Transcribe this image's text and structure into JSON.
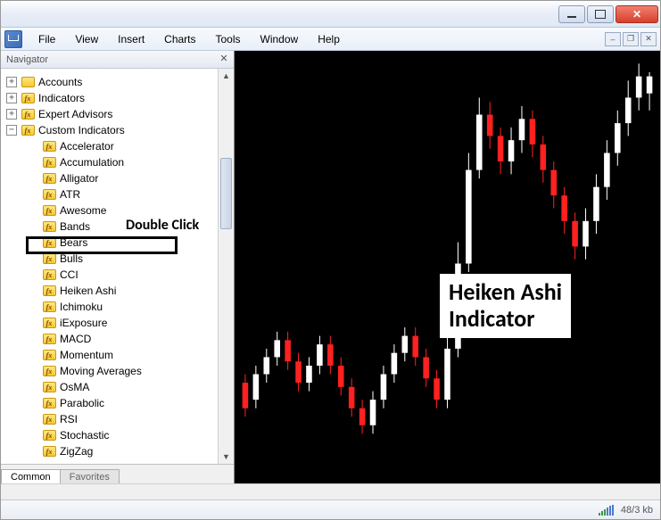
{
  "menubar": {
    "items": [
      "File",
      "View",
      "Insert",
      "Charts",
      "Tools",
      "Window",
      "Help"
    ]
  },
  "navigator": {
    "title": "Navigator",
    "tabs": {
      "active": "Common",
      "inactive": "Favorites"
    },
    "tree": {
      "top": [
        {
          "label": "Accounts",
          "expander": "+",
          "icon": "folder"
        },
        {
          "label": "Indicators",
          "expander": "+",
          "icon": "fx"
        },
        {
          "label": "Expert Advisors",
          "expander": "+",
          "icon": "fx"
        },
        {
          "label": "Custom Indicators",
          "expander": "−",
          "icon": "fx"
        }
      ],
      "custom": [
        "Accelerator",
        "Accumulation",
        "Alligator",
        "ATR",
        "Awesome",
        "Bands",
        "Bears",
        "Bulls",
        "CCI",
        "Heiken Ashi",
        "Ichimoku",
        "iExposure",
        "MACD",
        "Momentum",
        "Moving Averages",
        "OsMA",
        "Parabolic",
        "RSI",
        "Stochastic",
        "ZigZag"
      ],
      "highlighted": "Heiken Ashi"
    }
  },
  "annotations": {
    "double_click": "Double Click",
    "main_line1": "Heiken Ashi",
    "main_line2": "Indicator"
  },
  "statusbar": {
    "text": "48/3 kb"
  },
  "chart_data": {
    "type": "candlestick",
    "note": "approximate Heiken-Ashi candles, values read relative to panel (0=bottom,1=top)",
    "candles": [
      {
        "o": 0.22,
        "c": 0.16,
        "h": 0.24,
        "l": 0.14,
        "color": "red"
      },
      {
        "o": 0.18,
        "c": 0.24,
        "h": 0.26,
        "l": 0.16,
        "color": "white"
      },
      {
        "o": 0.24,
        "c": 0.28,
        "h": 0.3,
        "l": 0.22,
        "color": "white"
      },
      {
        "o": 0.28,
        "c": 0.32,
        "h": 0.34,
        "l": 0.26,
        "color": "white"
      },
      {
        "o": 0.32,
        "c": 0.27,
        "h": 0.34,
        "l": 0.25,
        "color": "red"
      },
      {
        "o": 0.27,
        "c": 0.22,
        "h": 0.29,
        "l": 0.2,
        "color": "red"
      },
      {
        "o": 0.22,
        "c": 0.26,
        "h": 0.28,
        "l": 0.2,
        "color": "white"
      },
      {
        "o": 0.26,
        "c": 0.31,
        "h": 0.33,
        "l": 0.24,
        "color": "white"
      },
      {
        "o": 0.31,
        "c": 0.26,
        "h": 0.33,
        "l": 0.24,
        "color": "red"
      },
      {
        "o": 0.26,
        "c": 0.21,
        "h": 0.28,
        "l": 0.19,
        "color": "red"
      },
      {
        "o": 0.21,
        "c": 0.16,
        "h": 0.23,
        "l": 0.14,
        "color": "red"
      },
      {
        "o": 0.16,
        "c": 0.12,
        "h": 0.18,
        "l": 0.1,
        "color": "red"
      },
      {
        "o": 0.12,
        "c": 0.18,
        "h": 0.2,
        "l": 0.1,
        "color": "white"
      },
      {
        "o": 0.18,
        "c": 0.24,
        "h": 0.26,
        "l": 0.16,
        "color": "white"
      },
      {
        "o": 0.24,
        "c": 0.29,
        "h": 0.31,
        "l": 0.22,
        "color": "white"
      },
      {
        "o": 0.29,
        "c": 0.33,
        "h": 0.35,
        "l": 0.27,
        "color": "white"
      },
      {
        "o": 0.33,
        "c": 0.28,
        "h": 0.35,
        "l": 0.26,
        "color": "red"
      },
      {
        "o": 0.28,
        "c": 0.23,
        "h": 0.3,
        "l": 0.21,
        "color": "red"
      },
      {
        "o": 0.23,
        "c": 0.18,
        "h": 0.25,
        "l": 0.16,
        "color": "red"
      },
      {
        "o": 0.18,
        "c": 0.3,
        "h": 0.34,
        "l": 0.16,
        "color": "white"
      },
      {
        "o": 0.3,
        "c": 0.5,
        "h": 0.55,
        "l": 0.28,
        "color": "white"
      },
      {
        "o": 0.5,
        "c": 0.72,
        "h": 0.76,
        "l": 0.48,
        "color": "white"
      },
      {
        "o": 0.72,
        "c": 0.85,
        "h": 0.89,
        "l": 0.7,
        "color": "white"
      },
      {
        "o": 0.85,
        "c": 0.8,
        "h": 0.88,
        "l": 0.77,
        "color": "red"
      },
      {
        "o": 0.8,
        "c": 0.74,
        "h": 0.82,
        "l": 0.71,
        "color": "red"
      },
      {
        "o": 0.74,
        "c": 0.79,
        "h": 0.82,
        "l": 0.71,
        "color": "white"
      },
      {
        "o": 0.79,
        "c": 0.84,
        "h": 0.87,
        "l": 0.76,
        "color": "white"
      },
      {
        "o": 0.84,
        "c": 0.78,
        "h": 0.86,
        "l": 0.75,
        "color": "red"
      },
      {
        "o": 0.78,
        "c": 0.72,
        "h": 0.8,
        "l": 0.69,
        "color": "red"
      },
      {
        "o": 0.72,
        "c": 0.66,
        "h": 0.74,
        "l": 0.63,
        "color": "red"
      },
      {
        "o": 0.66,
        "c": 0.6,
        "h": 0.68,
        "l": 0.57,
        "color": "red"
      },
      {
        "o": 0.6,
        "c": 0.54,
        "h": 0.62,
        "l": 0.51,
        "color": "red"
      },
      {
        "o": 0.54,
        "c": 0.6,
        "h": 0.63,
        "l": 0.51,
        "color": "white"
      },
      {
        "o": 0.6,
        "c": 0.68,
        "h": 0.71,
        "l": 0.57,
        "color": "white"
      },
      {
        "o": 0.68,
        "c": 0.76,
        "h": 0.79,
        "l": 0.65,
        "color": "white"
      },
      {
        "o": 0.76,
        "c": 0.83,
        "h": 0.86,
        "l": 0.73,
        "color": "white"
      },
      {
        "o": 0.83,
        "c": 0.89,
        "h": 0.93,
        "l": 0.8,
        "color": "white"
      },
      {
        "o": 0.89,
        "c": 0.94,
        "h": 0.97,
        "l": 0.86,
        "color": "white"
      },
      {
        "o": 0.94,
        "c": 0.9,
        "h": 0.95,
        "l": 0.86,
        "color": "white"
      }
    ]
  }
}
